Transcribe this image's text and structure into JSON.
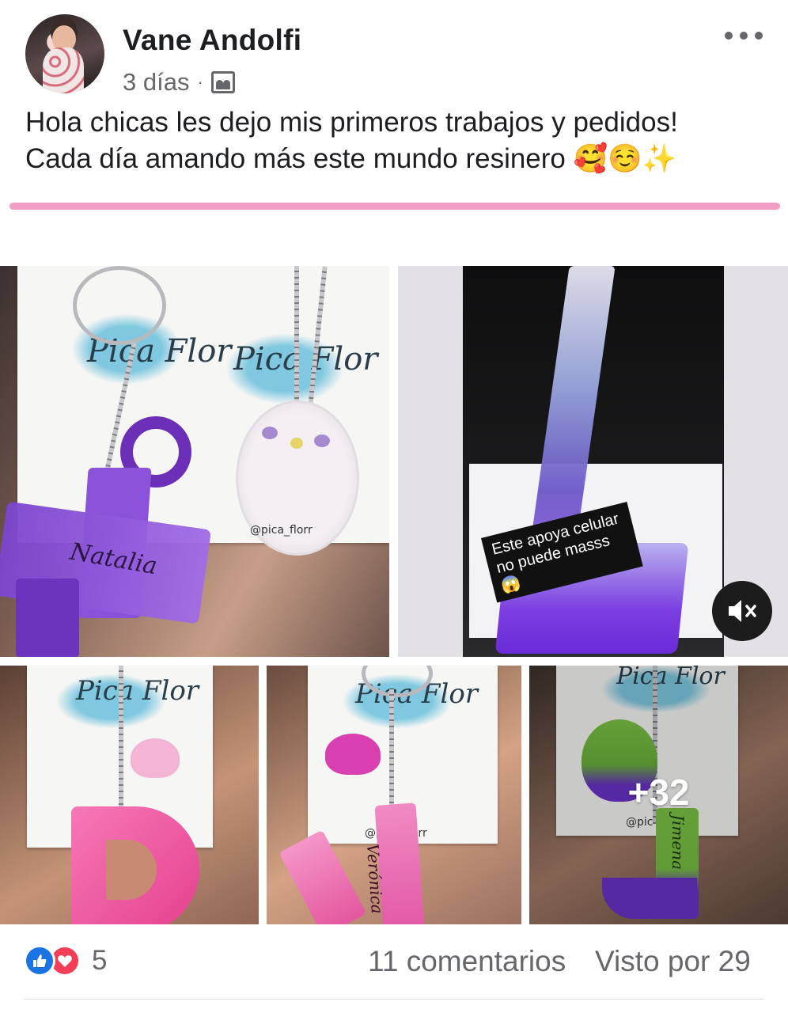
{
  "post": {
    "author": "Vane Andolfi",
    "time": "3 días",
    "separator": "·",
    "audience_icon": "group-icon",
    "text_line1": "Hola chicas les dejo mis primeros trabajos y pedidos!",
    "text_line2": "Cada día amando más este mundo resinero 🥰☺️✨"
  },
  "photos": {
    "photo1": {
      "brand1": "Pica Flor",
      "brand2": "Pica Flor",
      "name_text": "Natalia",
      "handle": "@pica_florr"
    },
    "photo2": {
      "caption_line1": "Este apoya celular",
      "caption_line2": "no puede masss 😱",
      "mute_icon": "speaker-muted-icon"
    },
    "photo3": {
      "brand": "Pica Flor"
    },
    "photo4": {
      "brand": "Pica Flor",
      "name_text": "Verónica",
      "handle": "@pica_florr"
    },
    "photo5": {
      "brand": "Pica Flor",
      "name_text": "Jimena",
      "handle": "@pic"
    },
    "more_count": "+32"
  },
  "footer": {
    "reaction_count": "5",
    "comments": "11 comentarios",
    "seen_by": "Visto por 29"
  },
  "colors": {
    "accent_pink": "#ee9fc3",
    "like_blue": "#1b74e4",
    "love_red": "#f33e58",
    "meta_gray": "#65676b"
  }
}
